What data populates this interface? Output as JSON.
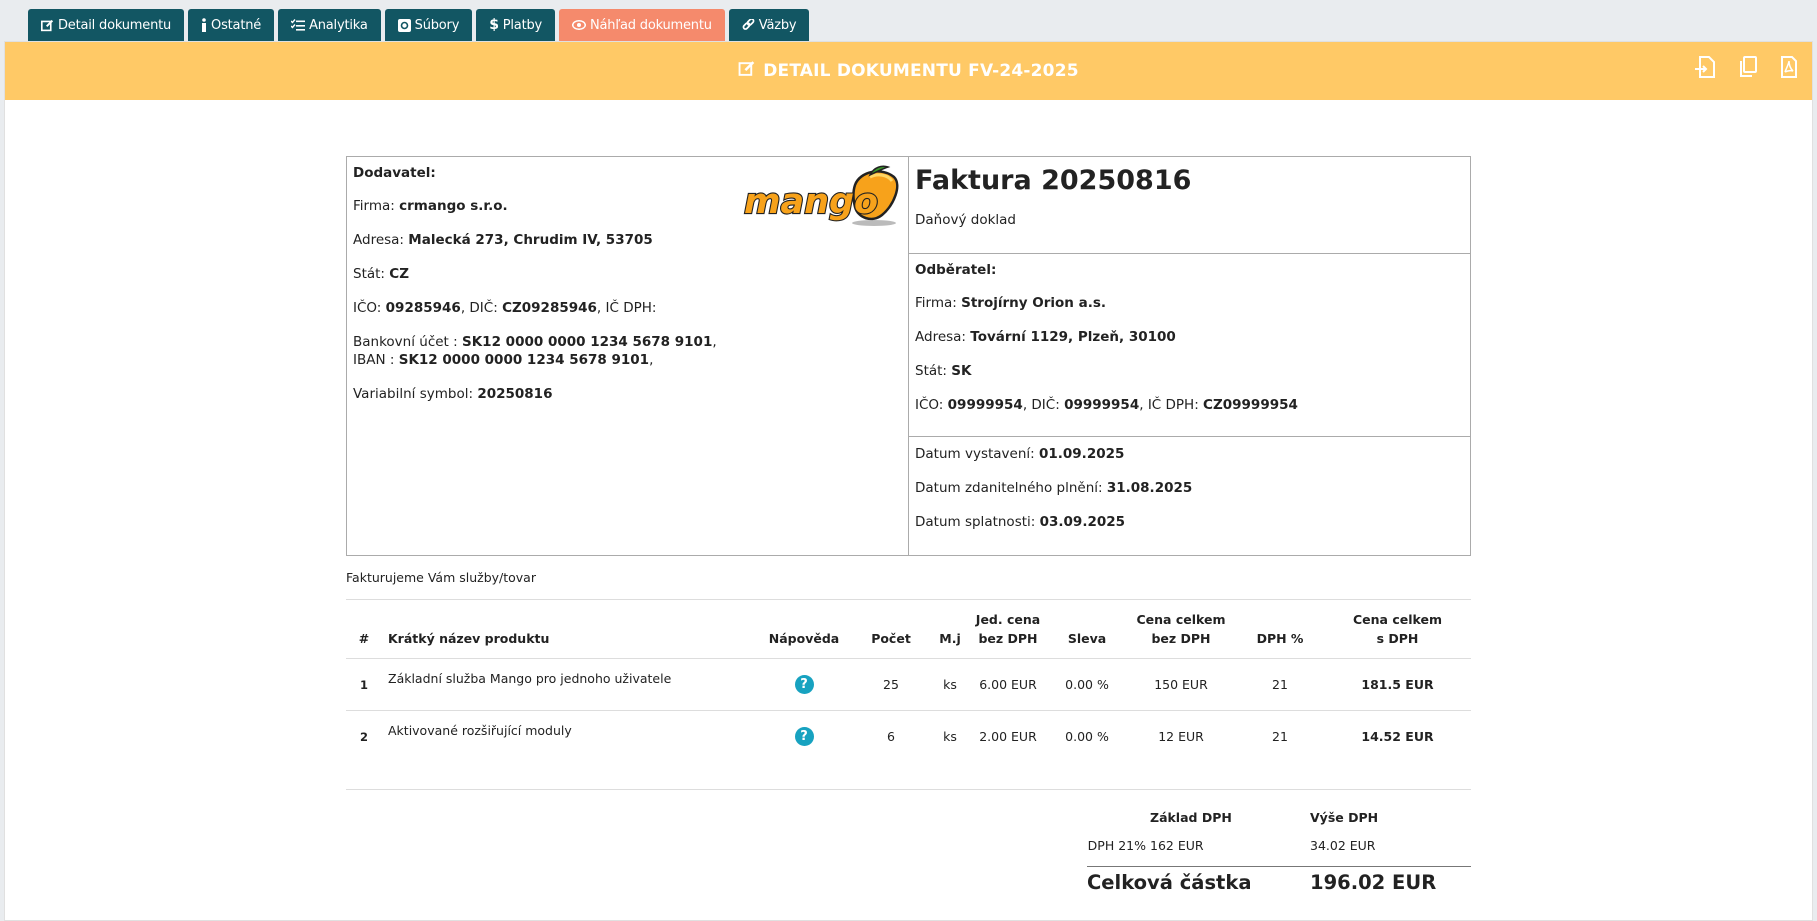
{
  "tabs": [
    {
      "label": "Detail dokumentu",
      "icon": "edit-icon"
    },
    {
      "label": "Ostatné",
      "icon": "info-icon"
    },
    {
      "label": "Analytika",
      "icon": "list-check-icon"
    },
    {
      "label": "Súbory",
      "icon": "file-icon"
    },
    {
      "label": "Platby",
      "icon": "dollar-icon"
    },
    {
      "label": "Náhľad dokumentu",
      "icon": "eye-icon",
      "active": true
    },
    {
      "label": "Väzby",
      "icon": "link-icon"
    }
  ],
  "header": {
    "title": "DETAIL DOKUMENTU FV-24-2025",
    "bg": "#ffc966"
  },
  "supplier": {
    "heading": "Dodavatel:",
    "firm_label": "Firma:",
    "firm": "crmango s.r.o.",
    "address_label": "Adresa:",
    "address": "Malecká 273, Chrudim IV, 53705",
    "country_label": "Stát:",
    "country": "CZ",
    "ico_label": "IČO:",
    "ico": "09285946",
    "dic_label": "DIČ:",
    "dic": "CZ09285946",
    "icdph_label": "IČ DPH:",
    "bank_label": "Bankovní účet :",
    "bank": "SK12 0000 0000 1234 5678 9101",
    "iban_label": "IBAN :",
    "iban": "SK12 0000 0000 1234 5678 9101",
    "vs_label": "Variabilní symbol:",
    "vs": "20250816",
    "logo_text": "mango"
  },
  "invoice": {
    "title": "Faktura 20250816",
    "subtitle": "Daňový doklad"
  },
  "customer": {
    "heading": "Odběratel:",
    "firm_label": "Firma:",
    "firm": "Strojírny Orion a.s.",
    "address_label": "Adresa:",
    "address": "Tovární 1129, Plzeň, 30100",
    "country_label": "Stát:",
    "country": "SK",
    "ico_label": "IČO:",
    "ico": "09999954",
    "dic_label": "DIČ:",
    "dic": "09999954",
    "icdph_label": "IČ DPH:",
    "icdph": "CZ09999954"
  },
  "dates": {
    "issued_label": "Datum vystavení:",
    "issued": "01.09.2025",
    "taxable_label": "Datum zdanitelného plnění:",
    "taxable": "31.08.2025",
    "due_label": "Datum splatnosti:",
    "due": "03.09.2025"
  },
  "intro": "Fakturujeme Vám služby/tovar",
  "table": {
    "headers": {
      "num": "#",
      "name": "Krátký název produktu",
      "help": "Nápověda",
      "qty": "Počet",
      "unit": "M.j",
      "unit_price_1": "Jed. cena",
      "unit_price_2": "bez DPH",
      "discount": "Sleva",
      "total_1": "Cena celkem",
      "total_2": "bez DPH",
      "vat": "DPH %",
      "total_vat_1": "Cena celkem",
      "total_vat_2": "s DPH"
    },
    "rows": [
      {
        "num": "1",
        "name": "Základní služba Mango pro jednoho uživatele",
        "help": "?",
        "qty": "25",
        "unit": "ks",
        "unit_price": "6.00 EUR",
        "discount": "0.00 %",
        "total": "150 EUR",
        "vat": "21",
        "total_vat": "181.5 EUR"
      },
      {
        "num": "2",
        "name": "Aktivované rozšiřující moduly",
        "help": "?",
        "qty": "6",
        "unit": "ks",
        "unit_price": "2.00 EUR",
        "discount": "0.00 %",
        "total": "12 EUR",
        "vat": "21",
        "total_vat": "14.52 EUR"
      }
    ]
  },
  "summary": {
    "base_header": "Základ DPH",
    "vat_header": "Výše DPH",
    "row_label": "DPH 21%",
    "base": "162 EUR",
    "vat": "34.02 EUR",
    "total_label": "Celková částka",
    "total": "196.02 EUR"
  }
}
